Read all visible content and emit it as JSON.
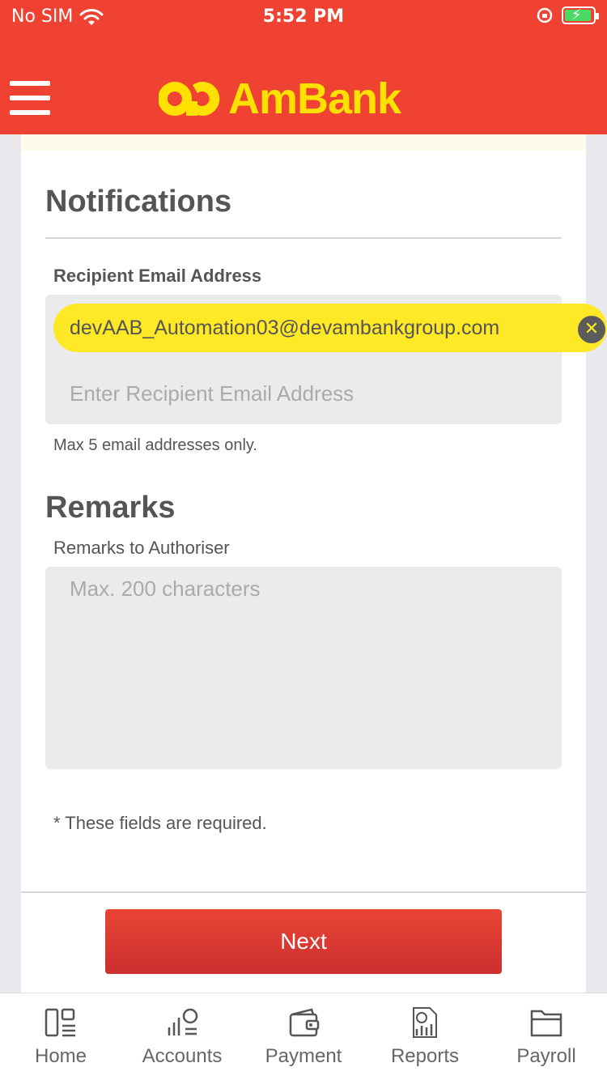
{
  "status_bar": {
    "carrier": "No SIM",
    "time": "5:52 PM"
  },
  "header": {
    "brand": "AmBank",
    "brand_color": "#ffe100",
    "accent_color": "#ef4233"
  },
  "notifications": {
    "title": "Notifications",
    "recipient_label": "Recipient Email Address",
    "recipient_emails": [
      "devAAB_Automation03@devambankgroup.com"
    ],
    "email_placeholder": "Enter Recipient Email Address",
    "email_hint": "Max 5 email addresses only."
  },
  "remarks": {
    "title": "Remarks",
    "label": "Remarks to Authoriser",
    "placeholder": "Max. 200 characters"
  },
  "required_note": "* These fields are required.",
  "next_label": "Next",
  "tabs": [
    {
      "label": "Home",
      "icon": "home-icon"
    },
    {
      "label": "Accounts",
      "icon": "accounts-icon"
    },
    {
      "label": "Payment",
      "icon": "wallet-icon"
    },
    {
      "label": "Reports",
      "icon": "reports-icon"
    },
    {
      "label": "Payroll",
      "icon": "folder-icon"
    }
  ]
}
